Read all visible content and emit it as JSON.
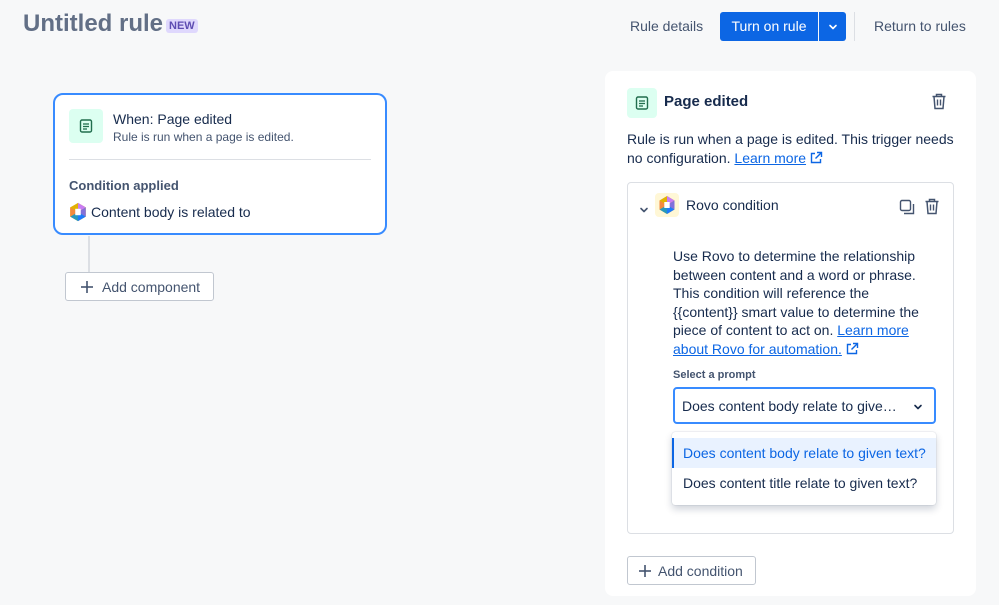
{
  "header": {
    "title": "Untitled rule",
    "badge": "NEW",
    "rule_details": "Rule details",
    "turn_on": "Turn on rule",
    "return": "Return to rules"
  },
  "trigger_card": {
    "title": "When: Page edited",
    "subtitle": "Rule is run when a page is edited.",
    "condition_heading": "Condition applied",
    "condition_text": "Content body is related to"
  },
  "canvas": {
    "add_component": "Add component"
  },
  "panel": {
    "title": "Page edited",
    "description": "Rule is run when a page is edited. This trigger needs no configuration.",
    "learn_more": "Learn more",
    "condition": {
      "title": "Rovo condition",
      "description": "Use Rovo to determine the relationship between content and a word or phrase. This condition will reference the {{content}} smart value to determine the piece of content to act on.",
      "link": "Learn more about Rovo for automation.",
      "prompt_label": "Select a prompt",
      "prompt_value": "Does content body relate to given text?",
      "options": [
        "Does content body relate to given text?",
        "Does content title relate to given text?"
      ]
    },
    "add_condition": "Add condition"
  },
  "colors": {
    "primary": "#0c66e4",
    "focus": "#388bff",
    "badge_bg": "#dfd8fd",
    "badge_text": "#5e4db2",
    "trigger_icon_bg": "#dcfff1"
  },
  "icons": [
    "page-icon",
    "rovo-icon",
    "chevron-down-icon",
    "trash-icon",
    "copy-icon",
    "external-link-icon",
    "plus-icon"
  ]
}
